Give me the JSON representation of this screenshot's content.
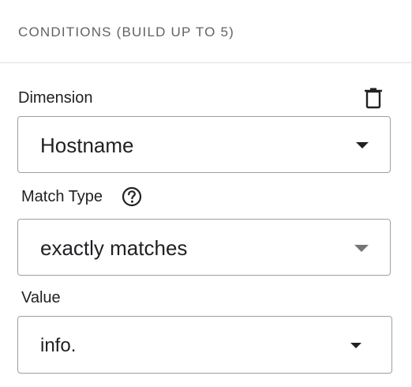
{
  "header": {
    "title": "CONDITIONS (BUILD UP TO 5)"
  },
  "dimension": {
    "label": "Dimension",
    "value": "Hostname",
    "delete_icon": "trash-icon"
  },
  "match_type": {
    "label": "Match Type",
    "help_icon": "help-circle-icon",
    "value": "exactly matches"
  },
  "value_field": {
    "label": "Value",
    "value": "info."
  },
  "colors": {
    "text": "#202124",
    "muted": "#5f6368",
    "border": "#9aa0a6",
    "divider": "#e0e0e0",
    "caret_dark": "#202124",
    "caret_light": "#757575"
  }
}
